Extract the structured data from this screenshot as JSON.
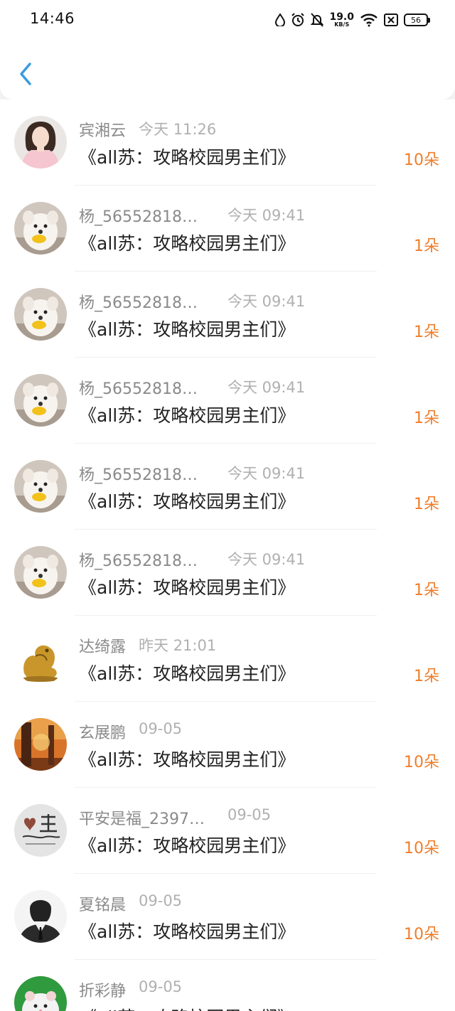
{
  "status_bar": {
    "time": "14:46",
    "net_speed": "19.0",
    "net_unit": "KB/S",
    "battery": "56"
  },
  "header": {
    "back_icon": "chevron-left-icon",
    "accent": "#3a9be0"
  },
  "colors": {
    "gift": "#ef7d2a",
    "name": "#8a8a8a",
    "time": "#b0b0b0"
  },
  "items": [
    {
      "name": "宾湘云",
      "time": "今天 11:26",
      "title": "《all苏：攻略校园男主们》",
      "gift": "10朵",
      "avatar": "girl-avatar"
    },
    {
      "name": "杨_565528185…",
      "time": "今天 09:41",
      "title": "《all苏：攻略校园男主们》",
      "gift": "1朵",
      "avatar": "dog-avatar"
    },
    {
      "name": "杨_565528185…",
      "time": "今天 09:41",
      "title": "《all苏：攻略校园男主们》",
      "gift": "1朵",
      "avatar": "dog-avatar"
    },
    {
      "name": "杨_565528185…",
      "time": "今天 09:41",
      "title": "《all苏：攻略校园男主们》",
      "gift": "1朵",
      "avatar": "dog-avatar"
    },
    {
      "name": "杨_565528185…",
      "time": "今天 09:41",
      "title": "《all苏：攻略校园男主们》",
      "gift": "1朵",
      "avatar": "dog-avatar"
    },
    {
      "name": "杨_565528185…",
      "time": "今天 09:41",
      "title": "《all苏：攻略校园男主们》",
      "gift": "1朵",
      "avatar": "dog-avatar"
    },
    {
      "name": "达绮露",
      "time": "昨天 21:01",
      "title": "《all苏：攻略校园男主们》",
      "gift": "1朵",
      "avatar": "golden-dragon-avatar"
    },
    {
      "name": "玄展鹏",
      "time": "09-05",
      "title": "《all苏：攻略校园男主们》",
      "gift": "10朵",
      "avatar": "autumn-forest-avatar"
    },
    {
      "name": "平安是福_2397…",
      "time": "09-05",
      "title": "《all苏：攻略校园男主们》",
      "gift": "10朵",
      "avatar": "calligraphy-avatar"
    },
    {
      "name": "夏铭晨",
      "time": "09-05",
      "title": "《all苏：攻略校园男主们》",
      "gift": "10朵",
      "avatar": "sketch-man-avatar"
    },
    {
      "name": "折彩静",
      "time": "09-05",
      "title": "《all苏：攻略校园男主们》",
      "gift": "",
      "avatar": "hamster-avatar"
    }
  ]
}
